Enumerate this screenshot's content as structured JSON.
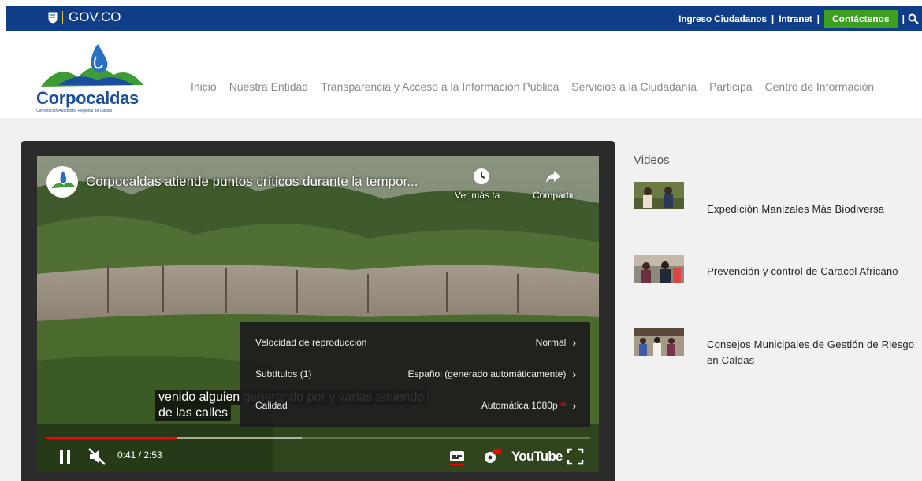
{
  "gov": {
    "brand": "GOV.CO"
  },
  "topnav": {
    "links": [
      "Ingreso Ciudadanos",
      "Intranet"
    ],
    "contact": "Contáctenos"
  },
  "logo": {
    "name": "Corpocaldas",
    "subtitle": "Corporación Autónoma Regional de Caldas"
  },
  "mainnav": [
    "Inicio",
    "Nuestra Entidad",
    "Transparencia y Acceso a la Información Pública",
    "Servicios a la Ciudadanía",
    "Participa",
    "Centro de Información"
  ],
  "player": {
    "title": "Corpocaldas atiende puntos críticos durante la tempor...",
    "watch_later": "Ver más ta...",
    "share": "Compartir",
    "settings": [
      {
        "label": "Velocidad de reproducción",
        "value": "Normal"
      },
      {
        "label": "Subtítulos (1)",
        "value": "Español (generado automáticamente)"
      },
      {
        "label": "Calidad",
        "value": "Automática 1080p",
        "badge": "HD"
      }
    ],
    "caption_line1": "venido alguien generando por y varias teniendo",
    "caption_line2": "de las calles",
    "time": "0:41 / 2:53",
    "progress_played": 0.24,
    "progress_buffered": 0.47,
    "logo_text": "YouTube",
    "colors": {
      "progress": "#ff0000",
      "settings_bg": "#1c1c1c"
    }
  },
  "sidebar": {
    "title": "Videos",
    "items": [
      {
        "label": "Expedición Manizales Más Biodiversa"
      },
      {
        "label": "Prevención y control de Caracol Africano"
      },
      {
        "label": "Consejos Municipales de Gestión de Riesgo en Caldas"
      }
    ]
  },
  "colors": {
    "gov_bar": "#0f3d87",
    "contact_button": "#3c9f1f",
    "brand_blue": "#1b4f9b"
  }
}
